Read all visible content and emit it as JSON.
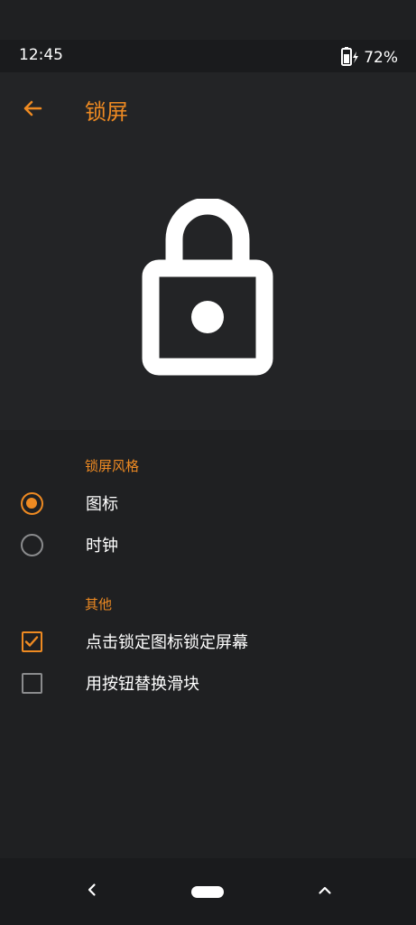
{
  "status_bar": {
    "time": "12:45",
    "battery_percent": "72%",
    "battery_icon": "battery-charging-icon"
  },
  "app_bar": {
    "title": "锁屏",
    "back_icon": "arrow-left-icon"
  },
  "hero": {
    "icon": "lock-icon"
  },
  "sections": {
    "lock_style": {
      "label": "锁屏风格",
      "options": [
        {
          "label": "图标",
          "selected": true
        },
        {
          "label": "时钟",
          "selected": false
        }
      ]
    },
    "other": {
      "label": "其他",
      "options": [
        {
          "label": "点击锁定图标锁定屏幕",
          "checked": true
        },
        {
          "label": "用按钮替换滑块",
          "checked": false
        }
      ]
    }
  },
  "nav_bar": {
    "back_icon": "chevron-left-icon",
    "home_icon": "home-pill-icon",
    "up_icon": "chevron-up-icon"
  },
  "colors": {
    "accent": "#ee8a22",
    "background": "#1f2022",
    "surface": "#232426",
    "bars": "#1a1b1d",
    "inactive_control": "#8a8b8d"
  }
}
